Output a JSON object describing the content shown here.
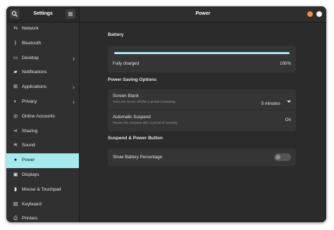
{
  "sidebar": {
    "title": "Settings",
    "search_icon": "search-icon",
    "menu_icon": "hamburger-menu-icon",
    "items": [
      {
        "label": "Network",
        "icon": "network-icon",
        "glyph": "⇆",
        "chevron": false
      },
      {
        "label": "Bluetooth",
        "icon": "bluetooth-icon",
        "glyph": "ᛒ",
        "chevron": false
      },
      {
        "label": "Desktop",
        "icon": "desktop-icon",
        "glyph": "▭",
        "chevron": true
      },
      {
        "label": "Notifications",
        "icon": "notifications-icon",
        "glyph": "▰",
        "chevron": false
      },
      {
        "label": "Applications",
        "icon": "applications-icon",
        "glyph": "⊞",
        "chevron": true
      },
      {
        "label": "Privacy",
        "icon": "privacy-icon",
        "glyph": "◐",
        "chevron": true
      },
      {
        "label": "Online Accounts",
        "icon": "online-accounts-icon",
        "glyph": "◎",
        "chevron": false
      },
      {
        "label": "Sharing",
        "icon": "sharing-icon",
        "glyph": "⋖",
        "chevron": false
      },
      {
        "label": "Sound",
        "icon": "sound-icon",
        "glyph": "≋",
        "chevron": false
      },
      {
        "label": "Power",
        "icon": "power-icon",
        "glyph": "●",
        "chevron": false,
        "active": true
      },
      {
        "label": "Displays",
        "icon": "displays-icon",
        "glyph": "▣",
        "chevron": false
      },
      {
        "label": "Mouse & Touchpad",
        "icon": "mouse-icon",
        "glyph": "▮",
        "chevron": false
      },
      {
        "label": "Keyboard",
        "icon": "keyboard-icon",
        "glyph": "▤",
        "chevron": false
      },
      {
        "label": "Printers",
        "icon": "printers-icon",
        "glyph": "⎙",
        "chevron": false
      }
    ]
  },
  "header": {
    "title": "Power",
    "minimize_color": "#f58a3a",
    "close_color": "#f5f5f5"
  },
  "battery": {
    "section_title": "Battery",
    "status": "Fully charged",
    "percent_text": "100%",
    "level": 1.0,
    "bar_color": "#a3ebee"
  },
  "power_saving": {
    "section_title": "Power Saving Options",
    "screen_blank": {
      "title": "Screen Blank",
      "subtitle": "Turns the screen off after a period of inactivity.",
      "value": "5 minutes"
    },
    "auto_suspend": {
      "title": "Automatic Suspend",
      "subtitle": "Pauses the computer after a period of inactivity.",
      "value": "On"
    }
  },
  "suspend": {
    "section_title": "Suspend & Power Button",
    "show_battery_percentage": {
      "title": "Show Battery Percentage",
      "enabled": false
    }
  },
  "colors": {
    "accent": "#a3ebee",
    "window_bg": "#2b2b2b",
    "card_bg": "#353535"
  }
}
